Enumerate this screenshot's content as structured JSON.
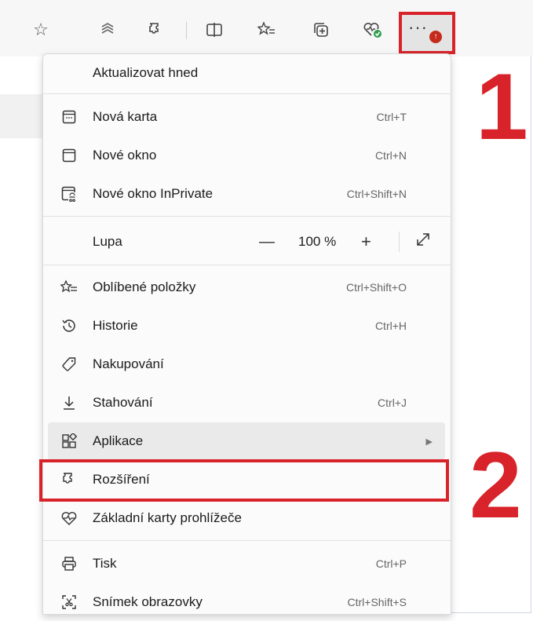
{
  "toolbar": {
    "icons": [
      "star-icon",
      "read-aloud-icon",
      "extensions-icon",
      "split-screen-icon",
      "favorites-icon",
      "collections-icon",
      "browser-essentials-icon",
      "more-icon"
    ]
  },
  "menu": {
    "update": "Aktualizovat hned",
    "items": [
      {
        "label": "Nová karta",
        "shortcut": "Ctrl+T",
        "icon": "new-tab-icon"
      },
      {
        "label": "Nové okno",
        "shortcut": "Ctrl+N",
        "icon": "new-window-icon"
      },
      {
        "label": "Nové okno InPrivate",
        "shortcut": "Ctrl+Shift+N",
        "icon": "inprivate-icon"
      }
    ],
    "zoom": {
      "label": "Lupa",
      "value": "100 %",
      "minus": "—",
      "plus": "+"
    },
    "items2": [
      {
        "label": "Oblíbené položky",
        "shortcut": "Ctrl+Shift+O",
        "icon": "favorites-icon"
      },
      {
        "label": "Historie",
        "shortcut": "Ctrl+H",
        "icon": "history-icon"
      },
      {
        "label": "Nakupování",
        "shortcut": "",
        "icon": "shopping-tag-icon"
      },
      {
        "label": "Stahování",
        "shortcut": "Ctrl+J",
        "icon": "download-icon"
      },
      {
        "label": "Aplikace",
        "shortcut": "",
        "icon": "apps-icon"
      },
      {
        "label": "Rozšíření",
        "shortcut": "",
        "icon": "extensions-icon"
      },
      {
        "label": "Základní karty prohlížeče",
        "shortcut": "",
        "icon": "browser-essentials-icon"
      }
    ],
    "items3": [
      {
        "label": "Tisk",
        "shortcut": "Ctrl+P",
        "icon": "print-icon"
      },
      {
        "label": "Snímek obrazovky",
        "shortcut": "Ctrl+Shift+S",
        "icon": "screenshot-icon"
      }
    ]
  },
  "annotations": {
    "step1": "1",
    "step2": "2"
  },
  "colors": {
    "highlight": "#d8232a",
    "menu_bg": "#fbfbfb",
    "toolbar_bg": "#f7f7f7"
  }
}
